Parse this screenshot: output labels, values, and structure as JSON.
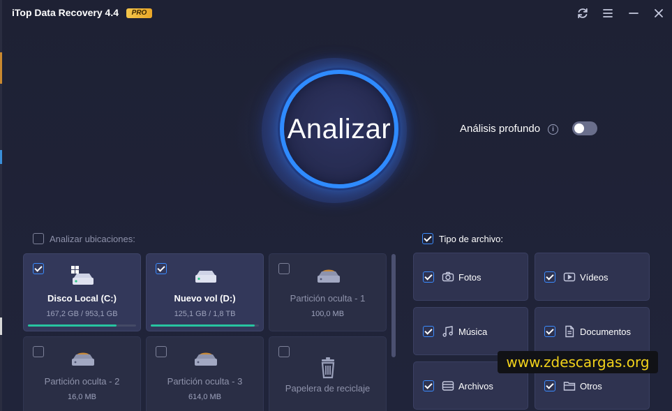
{
  "app": {
    "title": "iTop Data Recovery 4.4",
    "badge": "PRO"
  },
  "titlebar": {
    "refresh_icon": "refresh-icon",
    "menu_icon": "hamburger-menu-icon",
    "minimize_icon": "minimize-icon",
    "close_icon": "close-icon"
  },
  "analyze": {
    "label": "Analizar"
  },
  "deep_scan": {
    "label": "Análisis profundo",
    "info_glyph": "i",
    "enabled": false
  },
  "locations": {
    "label": "Analizar ubicaciones:",
    "checked": false,
    "drives": [
      {
        "name": "Disco Local (C:)",
        "size": "167,2 GB / 953,1 GB",
        "checked": true,
        "icon": "windows-drive-icon",
        "used_fraction": 0.82
      },
      {
        "name": "Nuevo vol (D:)",
        "size": "125,1 GB / 1,8 TB",
        "checked": true,
        "icon": "hard-drive-icon",
        "used_fraction": 0.96
      },
      {
        "name": "Partición oculta - 1",
        "size": "100,0 MB",
        "checked": false,
        "icon": "hidden-partition-icon"
      },
      {
        "name": "Partición oculta - 2",
        "size": "16,0 MB",
        "checked": false,
        "icon": "hidden-partition-icon"
      },
      {
        "name": "Partición oculta - 3",
        "size": "614,0 MB",
        "checked": false,
        "icon": "hidden-partition-icon"
      },
      {
        "name": "Papelera de reciclaje",
        "size": "",
        "checked": false,
        "icon": "recycle-bin-icon"
      }
    ]
  },
  "file_types": {
    "label": "Tipo de archivo:",
    "checked": true,
    "items": [
      {
        "label": "Fotos",
        "icon": "camera-icon",
        "checked": true
      },
      {
        "label": "Vídeos",
        "icon": "video-icon",
        "checked": true
      },
      {
        "label": "Música",
        "icon": "music-icon",
        "checked": true
      },
      {
        "label": "Documentos",
        "icon": "document-icon",
        "checked": true
      },
      {
        "label": "Archivos",
        "icon": "archive-icon",
        "checked": true
      },
      {
        "label": "Otros",
        "icon": "folder-icon",
        "checked": true
      }
    ]
  },
  "watermark": {
    "text": "www.zdescargas.org"
  },
  "colors": {
    "background": "#1f2233",
    "accent": "#2f8bff",
    "progress": "#27c4a0",
    "badge": "#f4c64b",
    "watermark_text": "#f2d21b"
  }
}
